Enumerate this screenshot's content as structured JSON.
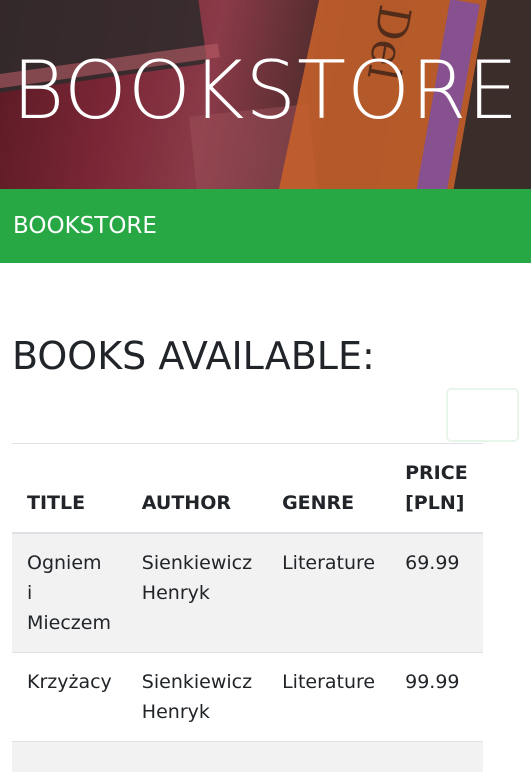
{
  "hero": {
    "title": "BOOKSTORE",
    "spine_text": "Del"
  },
  "navbar": {
    "brand": "BOOKSTORE",
    "toggler_icon": "hamburger-menu-icon"
  },
  "main": {
    "heading": "BOOKS AVAILABLE:",
    "table": {
      "headers": {
        "title": "TITLE",
        "author": "AUTHOR",
        "genre": "GENRE",
        "price": "PRICE [PLN]"
      },
      "rows": [
        {
          "title": "Ogniem i Mieczem",
          "author": "Sienkiewicz Henryk",
          "genre": "Literature",
          "price": "69.99"
        },
        {
          "title": "Krzyżacy",
          "author": "Sienkiewicz Henryk",
          "genre": "Literature",
          "price": "99.99"
        }
      ]
    }
  },
  "colors": {
    "navbar_bg": "#28a745",
    "stripe": "#f2f2f2",
    "text": "#212529"
  }
}
